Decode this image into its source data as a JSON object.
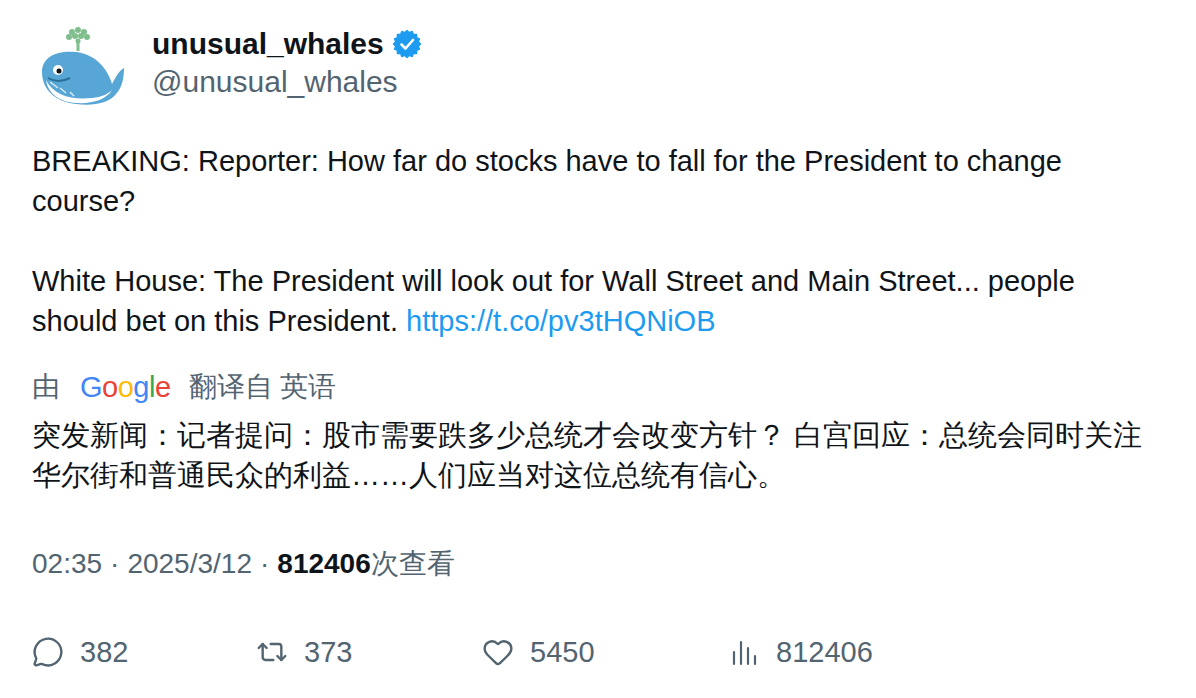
{
  "author": {
    "name": "unusual_whales",
    "handle": "@unusual_whales",
    "verified": true
  },
  "tweet": {
    "paragraphs": [
      {
        "text": "BREAKING: Reporter: How far do stocks have to fall for the President to change course?",
        "link": ""
      },
      {
        "text": "White House: The President will look out for Wall Street and Main Street... people should bet on this President.",
        "link": "https://t.co/pv3tHQNiOB"
      }
    ]
  },
  "translation": {
    "prefix": "由",
    "provider": "Google",
    "suffix": "翻译自 英语",
    "text": "突发新闻：记者提问：股市需要跌多少总统才会改变方针？ 白宫回应：总统会同时关注华尔街和普通民众的利益……人们应当对这位总统有信心。"
  },
  "meta": {
    "time": "02:35",
    "separator": "·",
    "date": "2025/3/12",
    "views": "812406",
    "views_label": "次查看"
  },
  "actions": [
    {
      "kind": "reply",
      "count": "382"
    },
    {
      "kind": "repost",
      "count": "373"
    },
    {
      "kind": "like",
      "count": "5450"
    },
    {
      "kind": "views",
      "count": "812406"
    }
  ]
}
